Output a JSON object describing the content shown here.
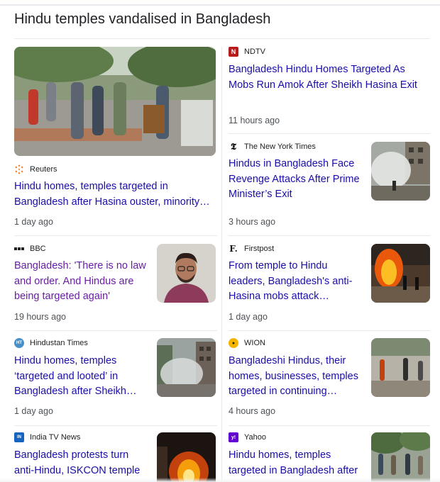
{
  "page": {
    "heading": "Hindu temples vandalised in Bangladesh"
  },
  "articles": {
    "reuters": {
      "source": "Reuters",
      "title": "Hindu homes, temples targeted in Bangladesh after Hasina ouster, minority…",
      "time": "1 day ago",
      "logo_icon": "reuters-dots-icon",
      "image": "street-crowd-photo"
    },
    "ndtv": {
      "source": "NDTV",
      "logo_text": "N",
      "title": "Bangladesh Hindu Homes Targeted As Mobs Run Amok After Sheikh Hasina Exit",
      "time": "11 hours ago"
    },
    "nyt": {
      "source": "The New York Times",
      "logo_text": "𝕿",
      "title": "Hindus in Bangladesh Face Revenge Attacks After Prime Minister’s Exit",
      "time": "3 hours ago",
      "image": "smoke-street-photo"
    },
    "bbc": {
      "source": "BBC",
      "logo_text": "▪▪▪",
      "title": "Bangladesh: 'There is no law and order. And Hindus are being targeted again'",
      "time": "19 hours ago",
      "image": "man-portrait-photo",
      "visited": true
    },
    "firstpost": {
      "source": "Firstpost",
      "logo_text": "F.",
      "title": "From temple to Hindu leaders, Bangladesh's anti-Hasina mobs attack…",
      "time": "1 day ago",
      "image": "fire-street-photo"
    },
    "ht": {
      "source": "Hindustan Times",
      "logo_text": "HT",
      "title": "Hindu homes, temples ‘targeted and looted’ in Bangladesh after Sheikh…",
      "time": "1 day ago",
      "image": "smoke-building-photo"
    },
    "wion": {
      "source": "WION",
      "logo_text": "●",
      "title": "Bangladeshi Hindus, their homes, businesses, temples targeted in continuing…",
      "time": "4 hours ago",
      "image": "protesters-street-photo"
    },
    "indiatv": {
      "source": "India TV News",
      "logo_text": "IN",
      "title": "Bangladesh protests turn anti-Hindu, ISKCON temple",
      "image": "night-fire-photo"
    },
    "yahoo": {
      "source": "Yahoo",
      "logo_text": "y!",
      "title": "Hindu homes, temples targeted in Bangladesh after",
      "image": "crowd-trees-photo"
    }
  },
  "colors": {
    "link": "#1a0dab",
    "visited_link": "#681da8",
    "meta": "#4d5156",
    "divider": "#e8eaed",
    "ndtv_red": "#b71c1c",
    "ht_blue": "#4a90c8",
    "indiatv_blue": "#1565c0",
    "yahoo_purple": "#6001d2",
    "wion_yellow": "#f4b400"
  }
}
